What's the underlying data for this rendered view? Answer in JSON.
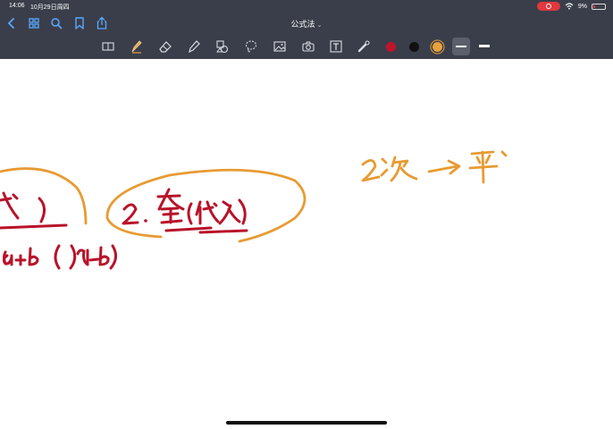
{
  "status_bar": {
    "time": "14:06",
    "date": "10月29日周四",
    "battery": "9%",
    "record_color": "#e0393e"
  },
  "nav": {
    "title": "公式法",
    "left_icons": [
      "back-chevron-icon",
      "grid-icon",
      "search-icon",
      "bookmark-icon",
      "share-icon"
    ]
  },
  "toolbar": {
    "tools": [
      "reader-icon",
      "pen-icon",
      "eraser-icon",
      "highlighter-icon",
      "shapes-icon",
      "lasso-icon",
      "image-icon",
      "camera-icon",
      "text-icon",
      "laser-icon"
    ],
    "colors": [
      "#c0142a",
      "#111111",
      "#e8a23c"
    ],
    "active_color": "#e8a23c"
  },
  "canvas": {
    "ink_colors": {
      "red": "#b8132a",
      "orange": "#e79b33"
    }
  }
}
